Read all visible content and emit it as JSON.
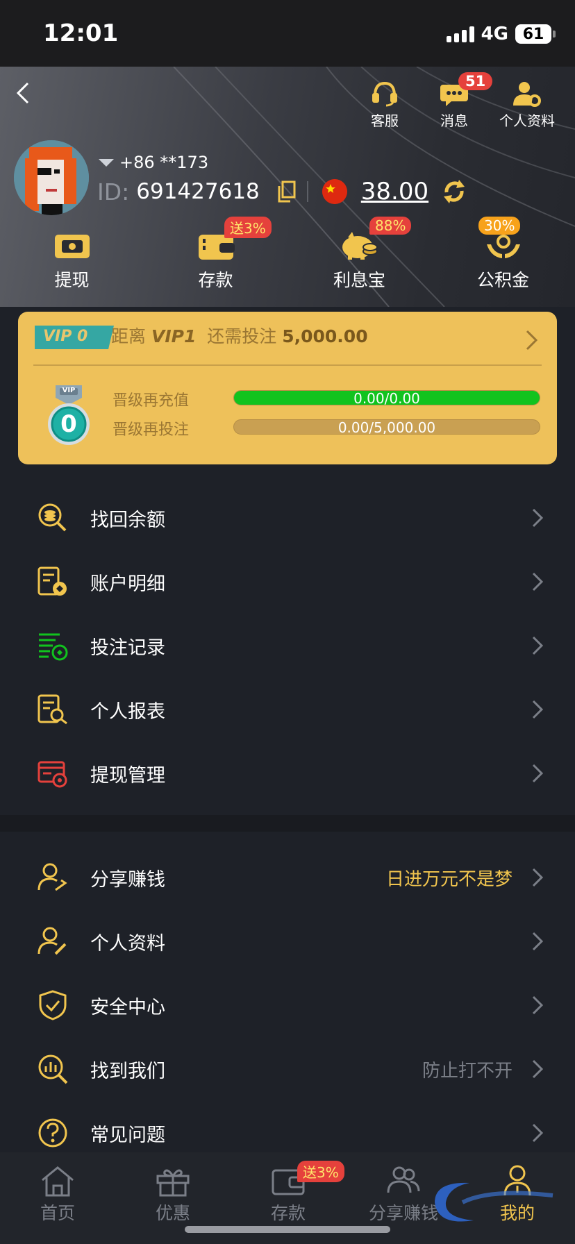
{
  "status_bar": {
    "time": "12:01",
    "network": "4G",
    "battery": "61"
  },
  "header": {
    "top_actions": [
      {
        "label": "客服",
        "icon": "headset-icon"
      },
      {
        "label": "消息",
        "icon": "chat-icon",
        "badge": "51"
      },
      {
        "label": "个人资料",
        "icon": "profile-gear-icon"
      }
    ],
    "phone": "+86 **173",
    "id_label": "ID:",
    "id_value": "691427618",
    "balance": "38.00"
  },
  "quick_actions": [
    {
      "label": "提现",
      "icon": "withdraw-ticket-icon"
    },
    {
      "label": "存款",
      "icon": "wallet-icon",
      "badge": "送3%"
    },
    {
      "label": "利息宝",
      "icon": "piggy-bank-icon",
      "badge": "88%"
    },
    {
      "label": "公积金",
      "icon": "hand-coin-icon",
      "badge": "30%"
    }
  ],
  "vip": {
    "tag": "VIP 0",
    "distance_prefix": "距离",
    "next_level": "VIP1",
    "need_text": "还需投注",
    "need_amount": "5,000.00",
    "medal_number": "0",
    "medal_ribbon": "VIP",
    "progress": [
      {
        "label": "晋级再充值",
        "text": "0.00/0.00",
        "fraction": 1.0,
        "color": "#11c31e"
      },
      {
        "label": "晋级再投注",
        "text": "0.00/5,000.00",
        "fraction": 0.0,
        "color": "#11c31e"
      }
    ]
  },
  "menu_group1": [
    {
      "label": "找回余额",
      "icon": "balance-search-icon"
    },
    {
      "label": "账户明细",
      "icon": "account-detail-icon"
    },
    {
      "label": "投注记录",
      "icon": "bet-record-icon"
    },
    {
      "label": "个人报表",
      "icon": "report-search-icon"
    },
    {
      "label": "提现管理",
      "icon": "withdraw-manage-icon"
    }
  ],
  "menu_group2": [
    {
      "label": "分享赚钱",
      "icon": "share-user-icon",
      "sub": "日进万元不是梦",
      "sub_color": "#f1c54e"
    },
    {
      "label": "个人资料",
      "icon": "user-edit-icon",
      "sub": "",
      "sub_color": ""
    },
    {
      "label": "安全中心",
      "icon": "shield-check-icon",
      "sub": "",
      "sub_color": ""
    },
    {
      "label": "找到我们",
      "icon": "find-us-icon",
      "sub": "防止打不开",
      "sub_color": "#7b7f88"
    },
    {
      "label": "常见问题",
      "icon": "question-icon",
      "sub": "",
      "sub_color": ""
    }
  ],
  "tabbar": [
    {
      "label": "首页",
      "icon": "home-icon",
      "active": false
    },
    {
      "label": "优惠",
      "icon": "gift-icon",
      "active": false
    },
    {
      "label": "存款",
      "icon": "wallet-icon",
      "active": false,
      "badge": "送3%"
    },
    {
      "label": "分享赚钱",
      "icon": "share-users-icon",
      "active": false
    },
    {
      "label": "我的",
      "icon": "me-icon",
      "active": true
    }
  ],
  "colors": {
    "accent": "#f1c54e",
    "vip_card": "#eec15a",
    "badge": "#e5413c",
    "progress": "#11c31e",
    "bg": "#1e2128"
  }
}
